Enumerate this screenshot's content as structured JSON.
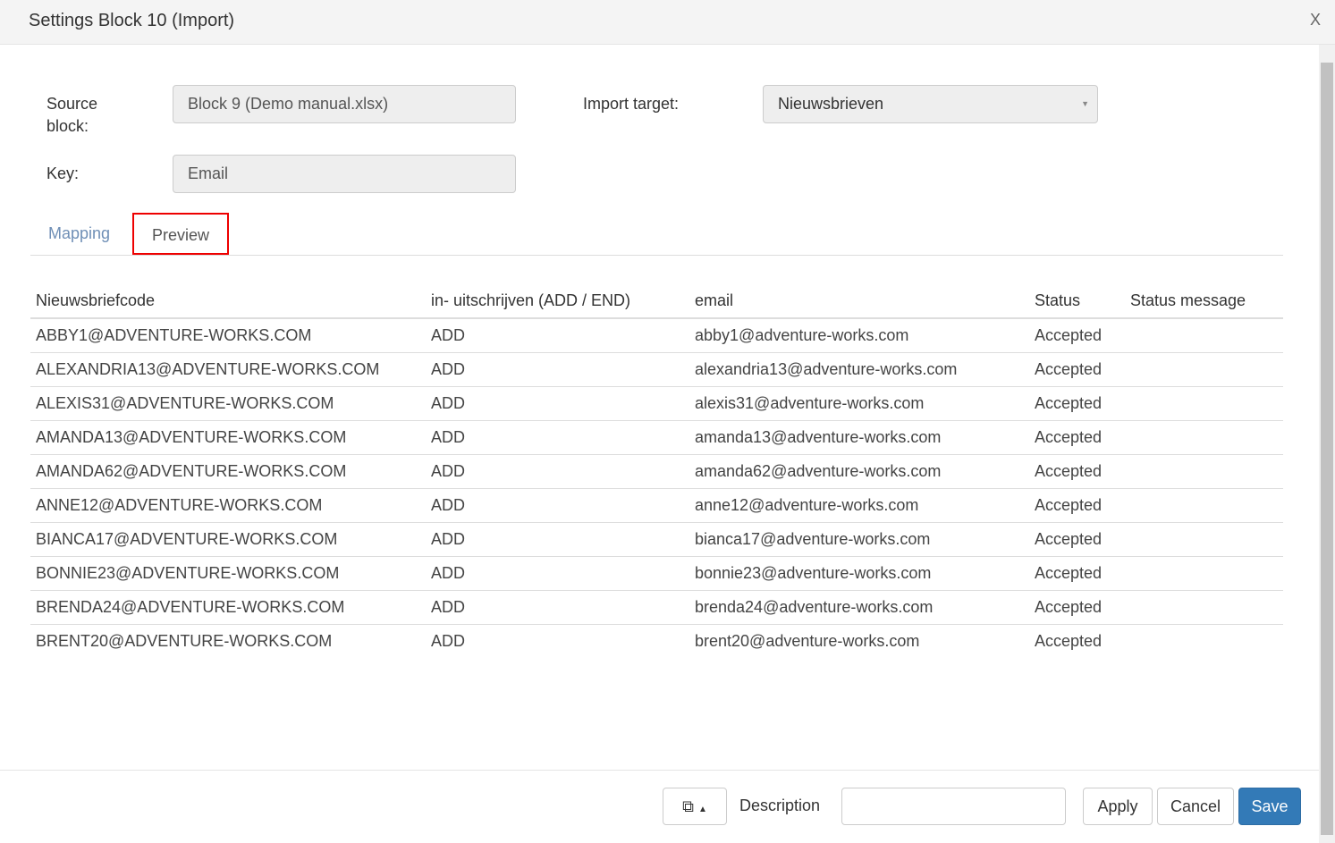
{
  "dialog": {
    "title": "Settings Block 10 (Import)",
    "close": "X"
  },
  "form": {
    "source_label": "Source block:",
    "source_value": "Block 9  (Demo manual.xlsx)",
    "key_label": "Key:",
    "key_value": "Email",
    "target_label": "Import target:",
    "target_value": "Nieuwsbrieven"
  },
  "tabs": [
    {
      "label": "Mapping"
    },
    {
      "label": "Preview"
    }
  ],
  "table": {
    "headers": [
      "Nieuwsbriefcode",
      "in- uitschrijven (ADD / END)",
      "email",
      "Status",
      "Status message"
    ],
    "rows": [
      [
        "ABBY1@ADVENTURE-WORKS.COM",
        "ADD",
        "abby1@adventure-works.com",
        "Accepted",
        ""
      ],
      [
        "ALEXANDRIA13@ADVENTURE-WORKS.COM",
        "ADD",
        "alexandria13@adventure-works.com",
        "Accepted",
        ""
      ],
      [
        "ALEXIS31@ADVENTURE-WORKS.COM",
        "ADD",
        "alexis31@adventure-works.com",
        "Accepted",
        ""
      ],
      [
        "AMANDA13@ADVENTURE-WORKS.COM",
        "ADD",
        "amanda13@adventure-works.com",
        "Accepted",
        ""
      ],
      [
        "AMANDA62@ADVENTURE-WORKS.COM",
        "ADD",
        "amanda62@adventure-works.com",
        "Accepted",
        ""
      ],
      [
        "ANNE12@ADVENTURE-WORKS.COM",
        "ADD",
        "anne12@adventure-works.com",
        "Accepted",
        ""
      ],
      [
        "BIANCA17@ADVENTURE-WORKS.COM",
        "ADD",
        "bianca17@adventure-works.com",
        "Accepted",
        ""
      ],
      [
        "BONNIE23@ADVENTURE-WORKS.COM",
        "ADD",
        "bonnie23@adventure-works.com",
        "Accepted",
        ""
      ],
      [
        "BRENDA24@ADVENTURE-WORKS.COM",
        "ADD",
        "brenda24@adventure-works.com",
        "Accepted",
        ""
      ],
      [
        "BRENT20@ADVENTURE-WORKS.COM",
        "ADD",
        "brent20@adventure-works.com",
        "Accepted",
        ""
      ]
    ]
  },
  "footer": {
    "description_label": "Description",
    "description_value": "",
    "apply": "Apply",
    "cancel": "Cancel",
    "save": "Save"
  }
}
